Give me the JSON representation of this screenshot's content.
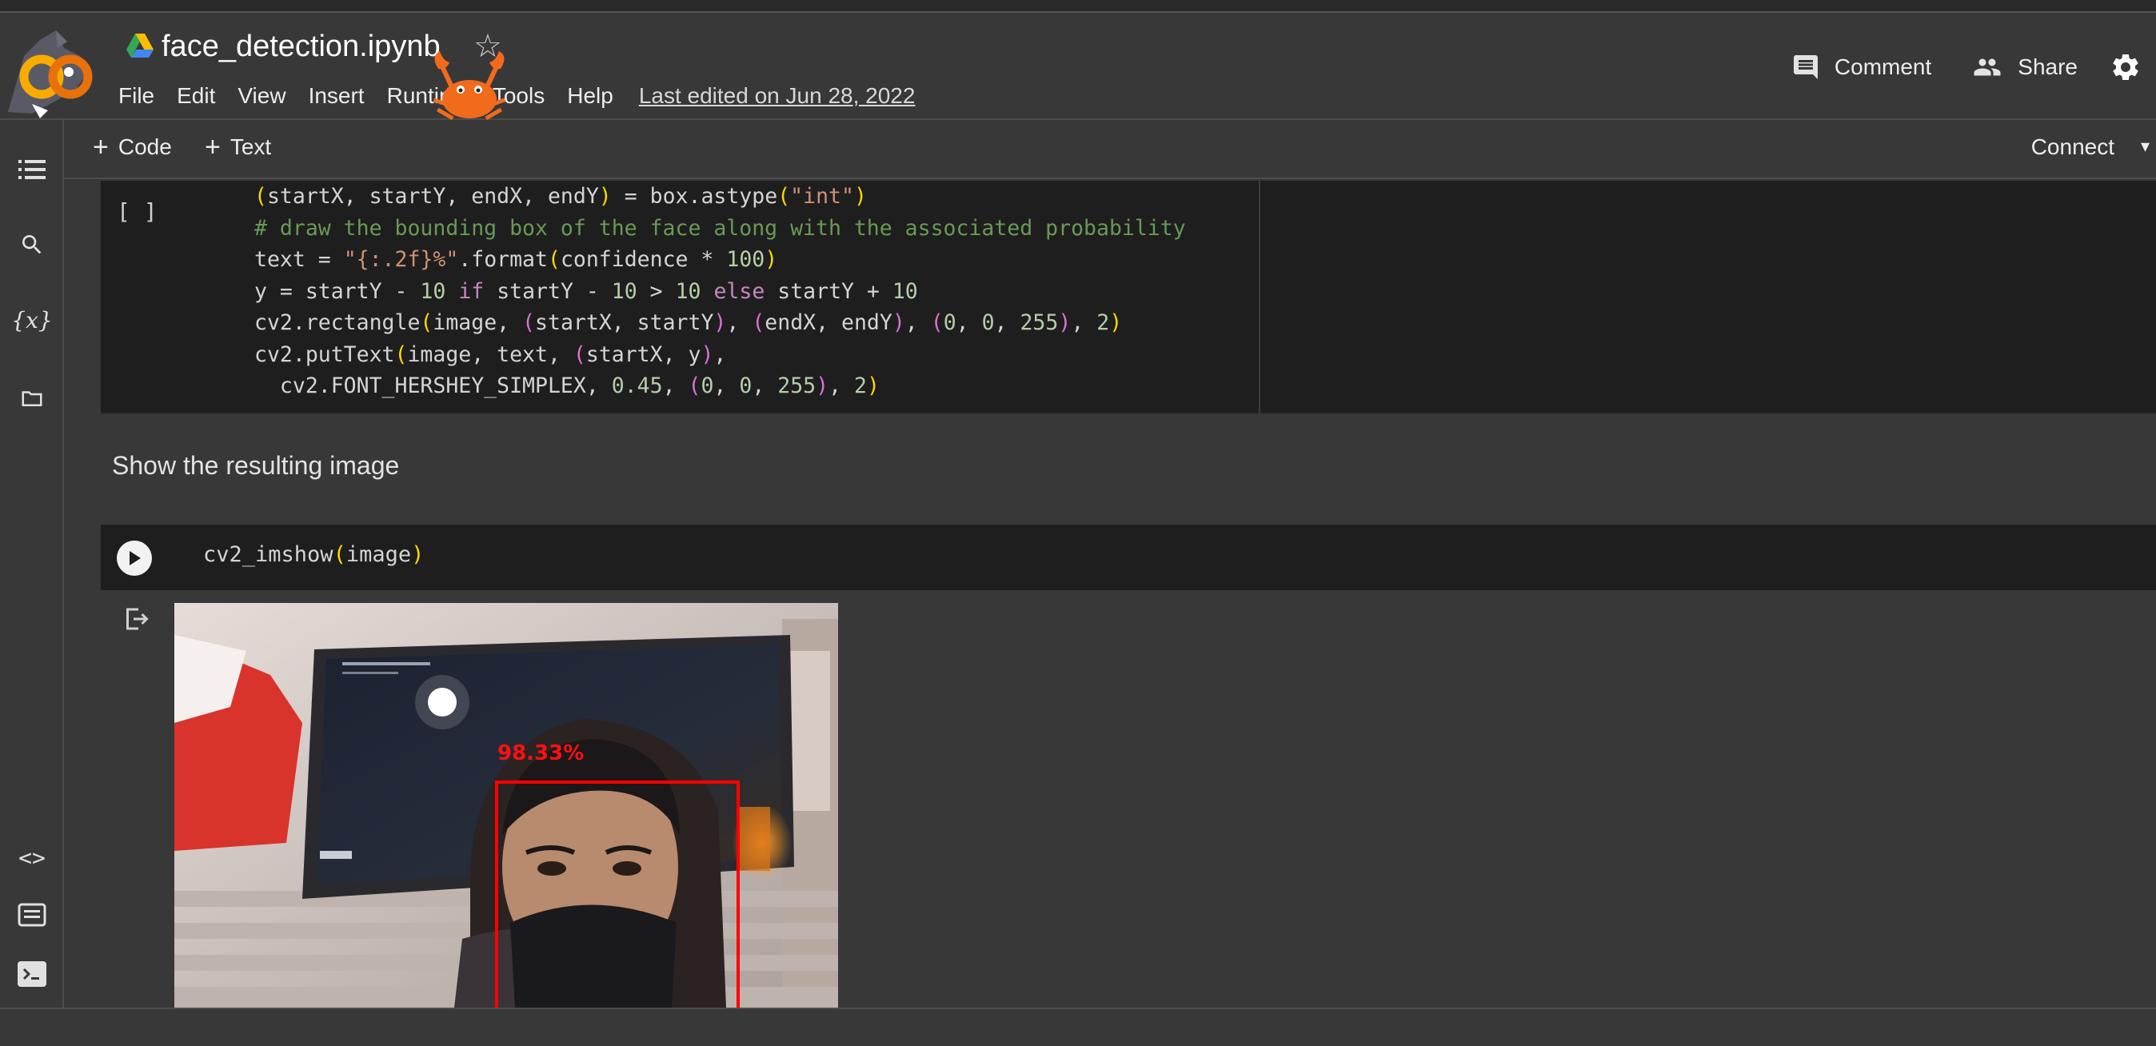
{
  "notebook": {
    "title": "face_detection.ipynb",
    "last_edited": "Last edited on Jun 28, 2022"
  },
  "menu": [
    "File",
    "Edit",
    "View",
    "Insert",
    "Runtime",
    "Tools",
    "Help"
  ],
  "header_actions": {
    "comment_label": "Comment",
    "share_label": "Share"
  },
  "toolbar": {
    "code_label": "Code",
    "text_label": "Text",
    "connect_label": "Connect"
  },
  "cells": {
    "code_cell_1": {
      "exec_marker": "[ ]",
      "lines": [
        "(startX, startY, endX, endY) = box.astype(\"int\")",
        "# draw the bounding box of the face along with the associated probability",
        "text = \"{:.2f}%\".format(confidence * 100)",
        "y = startY - 10 if startY - 10 > 10 else startY + 10",
        "cv2.rectangle(image, (startX, startY), (endX, endY), (0, 0, 255), 2)",
        "cv2.putText(image, text, (startX, y),",
        "  cv2.FONT_HERSHEY_SIMPLEX, 0.45, (0, 0, 255), 2)"
      ]
    },
    "text_cell": "Show the resulting image",
    "code_cell_2": {
      "code": "cv2_imshow(image)"
    },
    "output": {
      "detection_label": "98.33%",
      "box_color": "#ff0000"
    }
  },
  "colors": {
    "background": "#383838",
    "code_background": "#1e1e1e",
    "comment": "#6a9955",
    "string": "#ce9178",
    "keyword": "#c586c0"
  }
}
